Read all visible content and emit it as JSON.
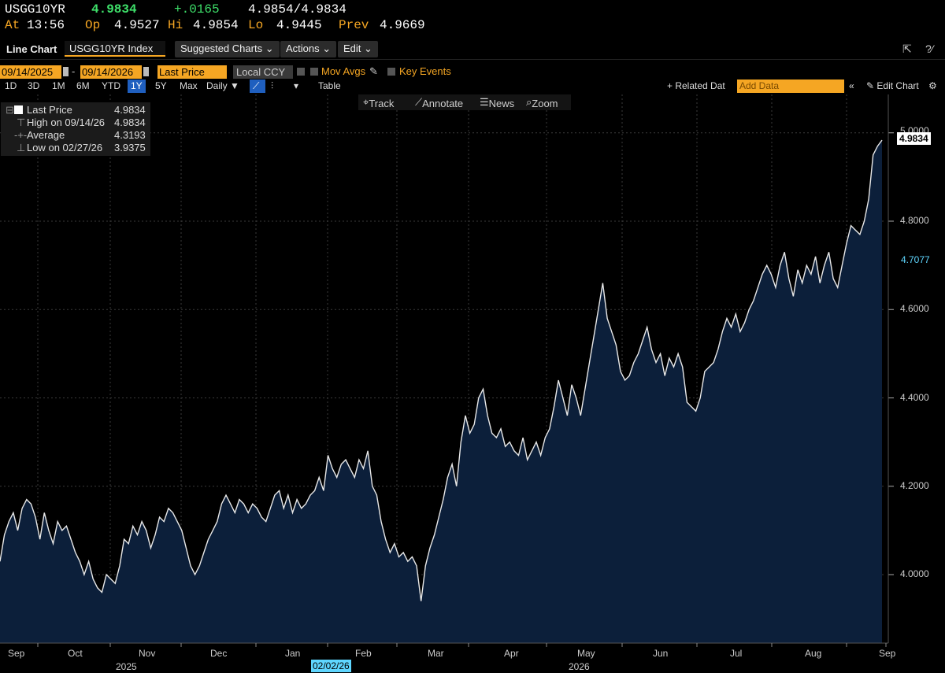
{
  "quote": {
    "ticker": "USGG10YR",
    "last": "4.9834",
    "change": "+.0165",
    "bid_ask": "4.9854/4.9834",
    "at_label": "At",
    "time": "13:56",
    "op_label": "Op",
    "open": "4.9527",
    "hi_label": "Hi",
    "high": "4.9854",
    "lo_label": "Lo",
    "low": "4.9445",
    "prev_label": "Prev",
    "prev": "4.9669"
  },
  "toolbar": {
    "title": "Line Chart",
    "security": "USGG10YR Index",
    "suggested": "Suggested Charts",
    "actions": "Actions",
    "edit": "Edit"
  },
  "range": {
    "start": "09/14/2025",
    "dash": "-",
    "end": "09/14/2026",
    "field": "Last Price",
    "currency": "Local CCY",
    "mov_avgs": "Mov Avgs",
    "key_events": "Key Events"
  },
  "periods": [
    "1D",
    "3D",
    "1M",
    "6M",
    "YTD",
    "1Y",
    "5Y",
    "Max"
  ],
  "active_period": "1Y",
  "frequency": "Daily ▼",
  "table_label": "Table",
  "related": "+ Related Dat",
  "add_data_placeholder": "Add Data",
  "edit_chart": "Edit Chart",
  "tools": {
    "track": "Track",
    "annotate": "Annotate",
    "news": "News",
    "zoom": "Zoom"
  },
  "legend": {
    "last_label": "Last Price",
    "last_value": "4.9834",
    "high_label": "High on 09/14/26",
    "high_value": "4.9834",
    "avg_label": "Average",
    "avg_value": "4.3193",
    "low_label": "Low on 02/27/26",
    "low_value": "3.9375"
  },
  "price_tags": {
    "last": "4.9834",
    "ref": "4.7077"
  },
  "colors": {
    "accent": "#f5a623",
    "positive": "#3ee06a",
    "area_fill": "#0c1f3a",
    "line": "#e8e8e8"
  },
  "chart_data": {
    "type": "area",
    "y_ticks": [
      "4.0000",
      "4.2000",
      "4.4000",
      "4.6000",
      "4.8000",
      "5.0000"
    ],
    "ylim": [
      3.8,
      5.02
    ],
    "x_months": [
      "Sep",
      "Oct",
      "Nov",
      "Dec",
      "Jan",
      "Feb",
      "Mar",
      "Apr",
      "May",
      "Jun",
      "Jul",
      "Aug",
      "Sep"
    ],
    "years": [
      "2025",
      "2026"
    ],
    "cursor_date": "02/02/26",
    "grid": true,
    "series": [
      {
        "values": [
          4.03,
          4.09,
          4.12,
          4.14,
          4.1,
          4.15,
          4.17,
          4.16,
          4.13,
          4.08,
          4.14,
          4.1,
          4.07,
          4.12,
          4.1,
          4.11,
          4.08,
          4.05,
          4.03,
          4.0,
          4.03,
          3.99,
          3.97,
          3.96,
          4.0,
          3.99,
          3.98,
          4.02,
          4.08,
          4.07,
          4.11,
          4.09,
          4.12,
          4.1,
          4.06,
          4.09,
          4.13,
          4.12,
          4.15,
          4.14,
          4.12,
          4.1,
          4.06,
          4.02,
          4.0,
          4.02,
          4.05,
          4.08,
          4.1,
          4.12,
          4.16,
          4.18,
          4.16,
          4.14,
          4.17,
          4.16,
          4.14,
          4.16,
          4.15,
          4.13,
          4.12,
          4.15,
          4.18,
          4.19,
          4.15,
          4.18,
          4.14,
          4.17,
          4.15,
          4.16,
          4.18,
          4.19,
          4.22,
          4.19,
          4.27,
          4.24,
          4.22,
          4.25,
          4.26,
          4.24,
          4.22,
          4.26,
          4.24,
          4.28,
          4.2,
          4.18,
          4.12,
          4.08,
          4.05,
          4.07,
          4.04,
          4.05,
          4.03,
          4.04,
          4.02,
          3.94,
          4.02,
          4.06,
          4.09,
          4.13,
          4.17,
          4.22,
          4.25,
          4.2,
          4.3,
          4.36,
          4.32,
          4.34,
          4.4,
          4.42,
          4.36,
          4.32,
          4.31,
          4.33,
          4.29,
          4.3,
          4.28,
          4.27,
          4.31,
          4.26,
          4.28,
          4.3,
          4.27,
          4.31,
          4.33,
          4.38,
          4.44,
          4.4,
          4.36,
          4.43,
          4.4,
          4.36,
          4.42,
          4.48,
          4.54,
          4.6,
          4.66,
          4.58,
          4.55,
          4.52,
          4.46,
          4.44,
          4.45,
          4.48,
          4.5,
          4.53,
          4.56,
          4.51,
          4.48,
          4.5,
          4.45,
          4.49,
          4.47,
          4.5,
          4.47,
          4.39,
          4.38,
          4.37,
          4.4,
          4.46,
          4.47,
          4.48,
          4.51,
          4.55,
          4.58,
          4.56,
          4.59,
          4.55,
          4.57,
          4.6,
          4.62,
          4.65,
          4.68,
          4.7,
          4.68,
          4.65,
          4.7,
          4.73,
          4.67,
          4.63,
          4.69,
          4.66,
          4.7,
          4.68,
          4.72,
          4.66,
          4.7,
          4.73,
          4.67,
          4.65,
          4.7,
          4.75,
          4.79,
          4.78,
          4.77,
          4.8,
          4.85,
          4.95,
          4.97,
          4.9834
        ]
      }
    ]
  }
}
